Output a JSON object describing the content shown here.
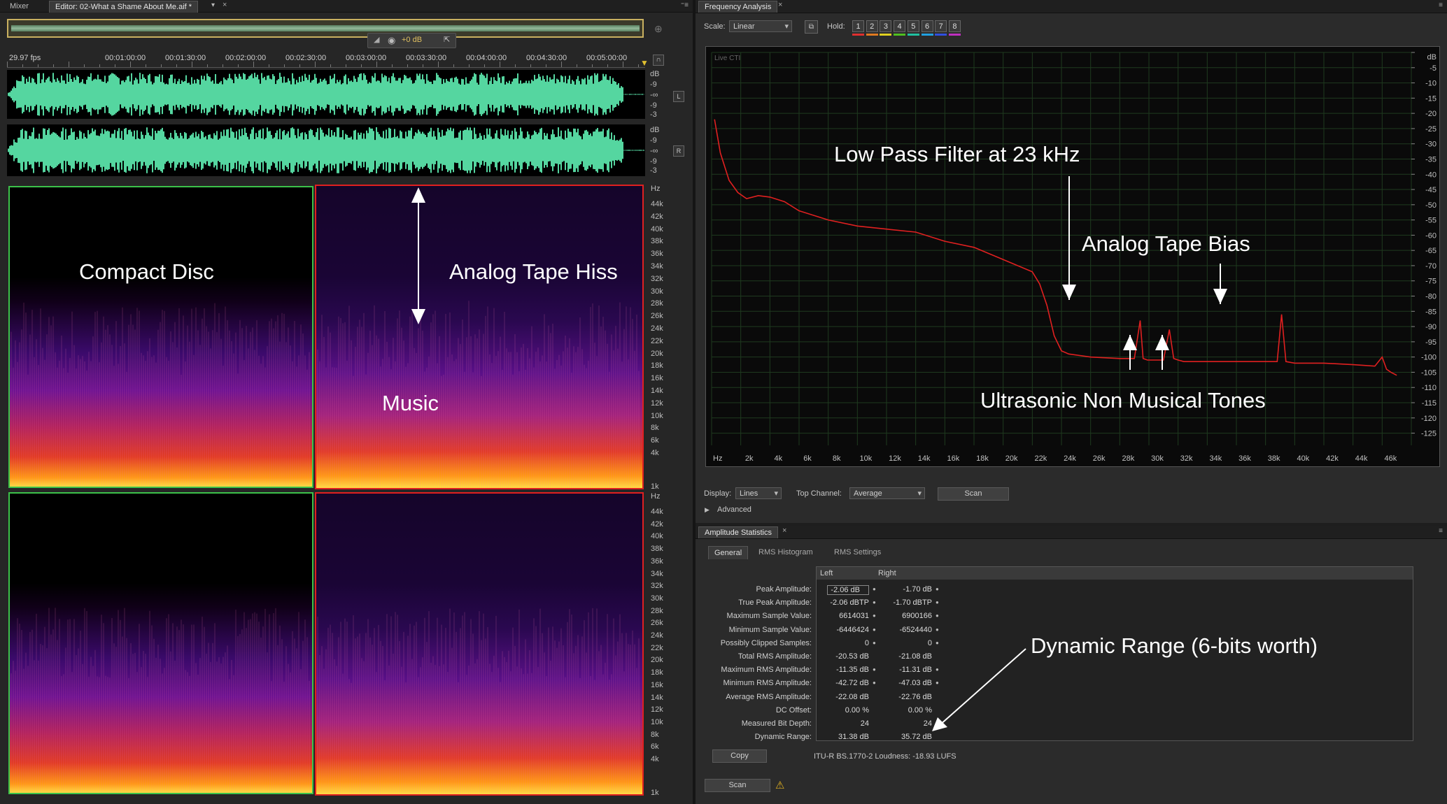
{
  "editor": {
    "tabs": [
      {
        "label": "Mixer"
      },
      {
        "label": "Editor: 02-What a Shame About Me.aif *"
      }
    ],
    "hud_gain": "+0 dB",
    "fps": "29.97 fps",
    "timeline": [
      "00:01:00:00",
      "00:01:30:00",
      "00:02:00:00",
      "00:02:30:00",
      "00:03:00:00",
      "00:03:30:00",
      "00:04:00:00",
      "00:04:30:00",
      "00:05:00:00"
    ],
    "wave_db_labels": [
      "dB",
      "-9",
      "-∞",
      "-9",
      "-3"
    ],
    "channel_left": "L",
    "channel_right": "R",
    "spectral_hz_unit": "Hz",
    "spectral_hz_labels": [
      "44k",
      "42k",
      "40k",
      "38k",
      "36k",
      "34k",
      "32k",
      "30k",
      "28k",
      "26k",
      "24k",
      "22k",
      "20k",
      "18k",
      "16k",
      "14k",
      "12k",
      "10k",
      "8k",
      "6k",
      "4k",
      "1k"
    ],
    "annotations": {
      "cd": "Compact Disc",
      "hiss": "Analog Tape Hiss",
      "music": "Music"
    }
  },
  "freq": {
    "title": "Frequency Analysis",
    "scale_label": "Scale:",
    "scale_value": "Linear",
    "hold_label": "Hold:",
    "holds": [
      {
        "n": "1",
        "color": "#e03030"
      },
      {
        "n": "2",
        "color": "#e07a20"
      },
      {
        "n": "3",
        "color": "#e0d020"
      },
      {
        "n": "4",
        "color": "#50c020"
      },
      {
        "n": "5",
        "color": "#20c0a0"
      },
      {
        "n": "6",
        "color": "#20a0e0"
      },
      {
        "n": "7",
        "color": "#3050e0"
      },
      {
        "n": "8",
        "color": "#c030c0"
      }
    ],
    "live_cti": "Live CTI",
    "x_labels": [
      "Hz",
      "2k",
      "4k",
      "6k",
      "8k",
      "10k",
      "12k",
      "14k",
      "16k",
      "18k",
      "20k",
      "22k",
      "24k",
      "26k",
      "28k",
      "30k",
      "32k",
      "34k",
      "36k",
      "38k",
      "40k",
      "42k",
      "44k",
      "46k"
    ],
    "y_labels": [
      "dB",
      "-5",
      "-10",
      "-15",
      "-20",
      "-25",
      "-30",
      "-35",
      "-40",
      "-45",
      "-50",
      "-55",
      "-60",
      "-65",
      "-70",
      "-75",
      "-80",
      "-85",
      "-90",
      "-95",
      "-100",
      "-105",
      "-110",
      "-115",
      "-120",
      "-125"
    ],
    "annotations": {
      "lpf": "Low Pass Filter at 23 kHz",
      "bias": "Analog Tape Bias",
      "tones": "Ultrasonic Non Musical Tones"
    },
    "display_label": "Display:",
    "display_value": "Lines",
    "top_channel_label": "Top Channel:",
    "top_channel_value": "Average",
    "scan_label": "Scan",
    "advanced_label": "Advanced"
  },
  "chart_data": {
    "type": "line",
    "xlabel": "Hz",
    "ylabel": "dB",
    "xlim": [
      0,
      48000
    ],
    "ylim": [
      -129,
      0
    ],
    "series": [
      {
        "color": "#e02020",
        "x": [
          200,
          600,
          1200,
          1800,
          2400,
          3200,
          4000,
          5000,
          6000,
          8000,
          10000,
          12000,
          14000,
          16000,
          18000,
          20000,
          21000,
          22000,
          22500,
          23000,
          23500,
          24000,
          24500,
          26000,
          28000,
          29000,
          29400,
          29600,
          29900,
          30200,
          31000,
          31400,
          31700,
          32000,
          32400,
          34000,
          36000,
          38000,
          38800,
          39100,
          39400,
          40000,
          42000,
          44000,
          45500,
          46000,
          46300,
          46600,
          47000
        ],
        "y": [
          -22,
          -33,
          -42,
          -46,
          -48,
          -47,
          -47.5,
          -49,
          -52,
          -55,
          -57,
          -58,
          -59,
          -62,
          -64,
          -68,
          -70,
          -72,
          -76,
          -83,
          -93,
          -98,
          -99,
          -100,
          -100.5,
          -100.5,
          -88,
          -100.5,
          -101,
          -101,
          -101,
          -91,
          -100.5,
          -101,
          -101.5,
          -101.5,
          -101.5,
          -101.5,
          -101.5,
          -86,
          -101.5,
          -102,
          -102,
          -102.5,
          -103,
          -100,
          -104,
          -105,
          -106
        ]
      }
    ]
  },
  "stats": {
    "title": "Amplitude Statistics",
    "tabs": [
      "General",
      "RMS Histogram",
      "RMS Settings"
    ],
    "col_left": "Left",
    "col_right": "Right",
    "rows": [
      {
        "label": "Peak Amplitude:",
        "left": "-2.06 dB",
        "right": "-1.70 dB"
      },
      {
        "label": "True Peak Amplitude:",
        "left": "-2.06 dBTP",
        "right": "-1.70 dBTP"
      },
      {
        "label": "Maximum Sample Value:",
        "left": "6614031",
        "right": "6900166"
      },
      {
        "label": "Minimum Sample Value:",
        "left": "-6446424",
        "right": "-6524440"
      },
      {
        "label": "Possibly Clipped Samples:",
        "left": "0",
        "right": "0"
      },
      {
        "label": "Total RMS Amplitude:",
        "left": "-20.53 dB",
        "right": "-21.08 dB"
      },
      {
        "label": "Maximum RMS Amplitude:",
        "left": "-11.35 dB",
        "right": "-11.31 dB"
      },
      {
        "label": "Minimum RMS Amplitude:",
        "left": "-42.72 dB",
        "right": "-47.03 dB"
      },
      {
        "label": "Average RMS Amplitude:",
        "left": "-22.08 dB",
        "right": "-22.76 dB"
      },
      {
        "label": "DC Offset:",
        "left": "0.00 %",
        "right": "0.00 %"
      },
      {
        "label": "Measured Bit Depth:",
        "left": "24",
        "right": "24"
      },
      {
        "label": "Dynamic Range:",
        "left": "31.38 dB",
        "right": "35.72 dB"
      }
    ],
    "dynamic_annotation": "Dynamic Range (6-bits worth)",
    "copy_label": "Copy",
    "loudness": "ITU-R BS.1770-2 Loudness: -18.93 LUFS",
    "scan_label": "Scan"
  }
}
